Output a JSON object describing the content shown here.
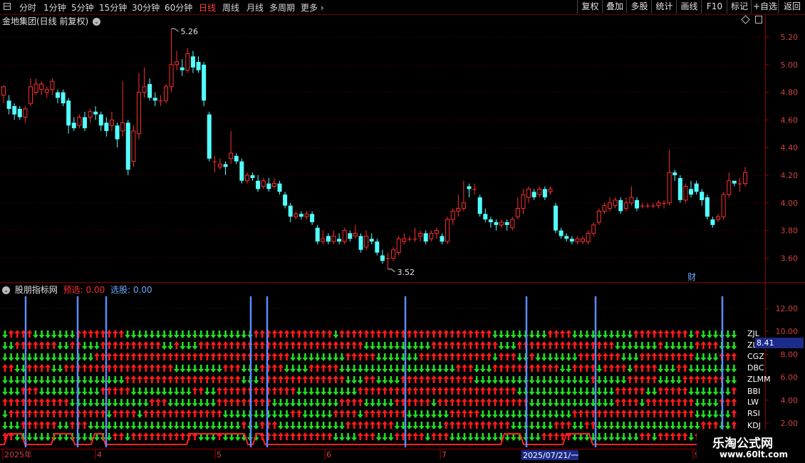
{
  "toolbar": {
    "periods": [
      "分时",
      "1分钟",
      "5分钟",
      "15分钟",
      "30分钟",
      "60分钟",
      "日线",
      "周线",
      "月线",
      "多周期",
      "更多"
    ],
    "active_period": "日线",
    "right_buttons": [
      "复权",
      "叠加",
      "多股",
      "统计",
      "画线",
      "F10",
      "标记",
      "+自选",
      "返回"
    ]
  },
  "main_chart": {
    "title": "金地集团(日线 前复权)",
    "high_label": "5.26",
    "low_label": "3.52",
    "cai_label": "财",
    "price_axis": [
      "5.20",
      "5.00",
      "4.80",
      "4.60",
      "4.40",
      "4.20",
      "4.00",
      "3.80",
      "3.60"
    ]
  },
  "indicator": {
    "name": "股朋指标网",
    "yuxuan_label": "预选:",
    "yuxuan_value": "0.00",
    "xuangu_label": "选股:",
    "xuangu_value": "0.00",
    "axis": [
      "12.00",
      "10.00",
      "8.00",
      "6.00",
      "4.00",
      "2.00"
    ],
    "row_labels": [
      "ZJL",
      "ZLG",
      "CGZ",
      "DBC",
      "ZLMM",
      "BBI",
      "LW",
      "RSI",
      "KDJ"
    ],
    "highlight_value": "8.41"
  },
  "date_axis": {
    "labels": [
      "2025年",
      "4",
      "5",
      "6",
      "7",
      "9"
    ],
    "highlight": "2025/07/21/一"
  },
  "watermark": {
    "line1": "乐淘公式网",
    "line2": "www.60lt.com"
  },
  "colors": {
    "up": "#ff3030",
    "down": "#54ffff",
    "arrow_up": "#ff1a1a",
    "arrow_down": "#22dd22",
    "signal_line": "#5b8cff",
    "grid": "#5a0000"
  }
}
